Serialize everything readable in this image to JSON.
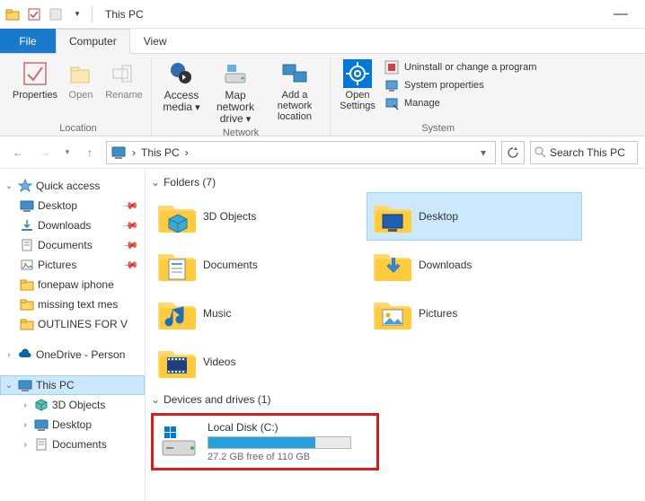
{
  "titlebar": {
    "title": "This PC"
  },
  "tabs": {
    "file": "File",
    "computer": "Computer",
    "view": "View"
  },
  "ribbon": {
    "location": {
      "label": "Location",
      "properties": "Properties",
      "open": "Open",
      "rename": "Rename"
    },
    "network": {
      "label": "Network",
      "access": "Access media",
      "map": "Map network drive",
      "addloc": "Add a network location"
    },
    "settings": {
      "open": "Open Settings"
    },
    "system": {
      "label": "System",
      "uninstall": "Uninstall or change a program",
      "props": "System properties",
      "manage": "Manage"
    }
  },
  "nav": {
    "path": "This PC",
    "chevron": "›"
  },
  "search": {
    "placeholder": "Search This PC"
  },
  "tree": {
    "quick": "Quick access",
    "items": [
      "Desktop",
      "Downloads",
      "Documents",
      "Pictures",
      "fonepaw iphone",
      "missing text mes",
      "OUTLINES FOR V"
    ],
    "onedrive": "OneDrive - Person",
    "thispc": "This PC",
    "pc": [
      "3D Objects",
      "Desktop",
      "Documents"
    ]
  },
  "sections": {
    "folders": {
      "title": "Folders (7)",
      "items": [
        "3D Objects",
        "Desktop",
        "Documents",
        "Downloads",
        "Music",
        "Pictures",
        "Videos"
      ],
      "selected": 1
    },
    "drives": {
      "title": "Devices and drives (1)",
      "drive": {
        "name": "Local Disk (C:)",
        "free": "27.2 GB free of 110 GB",
        "pct": 75
      }
    }
  }
}
